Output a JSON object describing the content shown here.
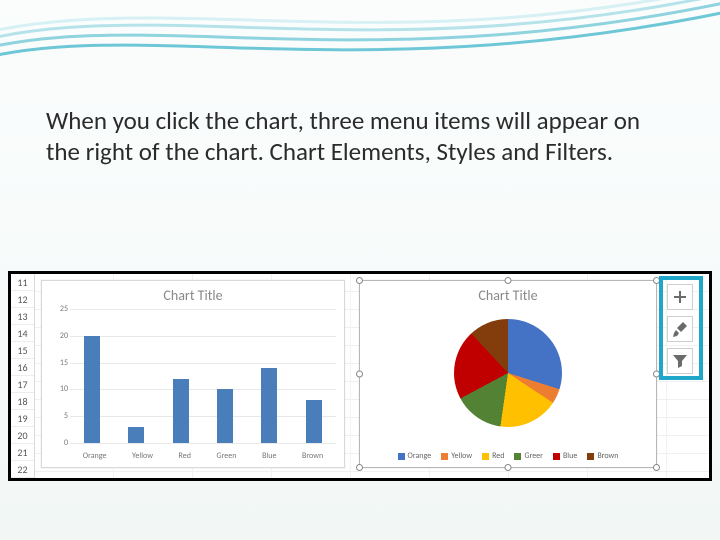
{
  "slide": {
    "text": "When you click the chart, three menu items will appear on the right of the chart. Chart Elements, Styles and Filters."
  },
  "rows": [
    "11",
    "12",
    "13",
    "14",
    "15",
    "16",
    "17",
    "18",
    "19",
    "20",
    "21",
    "22"
  ],
  "bar_title": "Chart Title",
  "pie_title": "Chart Title",
  "legend": {
    "orange": "Orange",
    "yellow": "Yellow",
    "red": "Red",
    "green": "Greer",
    "blue": "Blue",
    "brown": "Brown"
  },
  "tools": {
    "elements": "Chart Elements",
    "styles": "Chart Styles",
    "filters": "Chart Filters"
  },
  "colors": {
    "orange": "#ed7d31",
    "yellow": "#ffc000",
    "red": "#c00000",
    "green": "#548235",
    "blue": "#4472c4",
    "brown": "#833c0c",
    "bar_fill": "#4a7ebb"
  },
  "chart_data": [
    {
      "type": "bar",
      "title": "Chart Title",
      "categories": [
        "Orange",
        "Yellow",
        "Red",
        "Green",
        "Blue",
        "Brown"
      ],
      "values": [
        20,
        3,
        12,
        10,
        14,
        8
      ],
      "ylim": [
        0,
        25
      ],
      "yticks": [
        0,
        5,
        10,
        15,
        20,
        25
      ]
    },
    {
      "type": "pie",
      "title": "Chart Title",
      "slices": [
        {
          "name": "Orange",
          "value": 20,
          "color": "#4472c4"
        },
        {
          "name": "Yellow",
          "value": 3,
          "color": "#ed7d31"
        },
        {
          "name": "Red",
          "value": 12,
          "color": "#ffc000"
        },
        {
          "name": "Green",
          "value": 10,
          "color": "#548235"
        },
        {
          "name": "Blue",
          "value": 14,
          "color": "#c00000"
        },
        {
          "name": "Brown",
          "value": 8,
          "color": "#833c0c"
        }
      ]
    }
  ]
}
